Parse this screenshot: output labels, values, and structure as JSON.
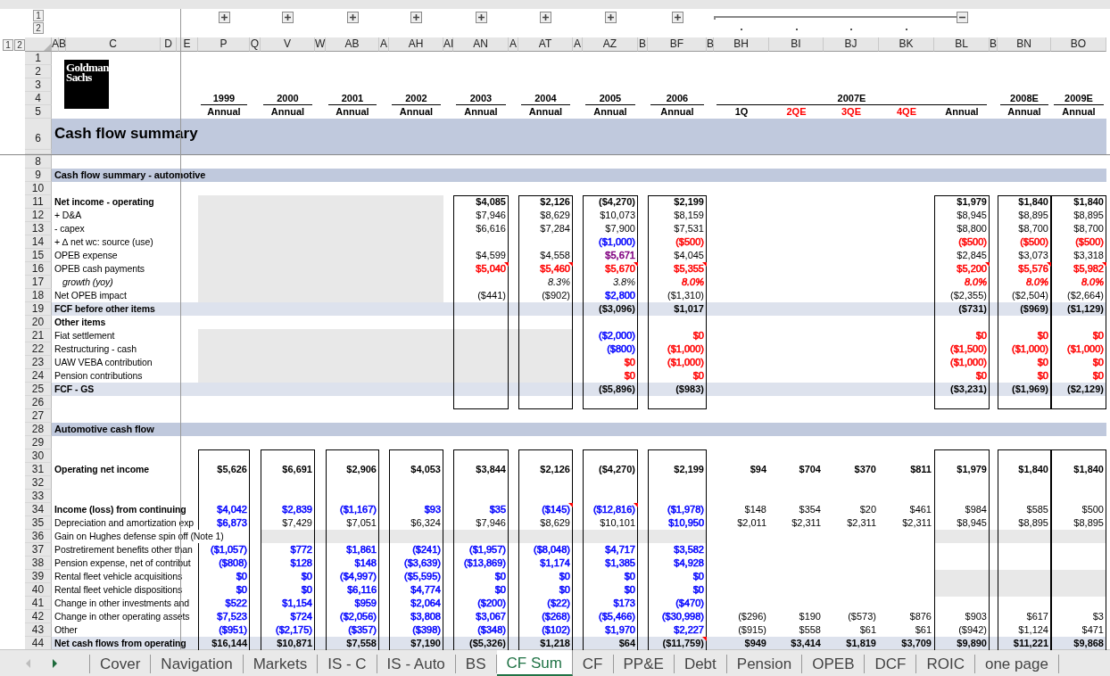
{
  "outline": {
    "levels": [
      "1",
      "2"
    ],
    "groups": [
      {
        "expanded": false
      },
      {
        "expanded": false
      },
      {
        "expanded": false
      },
      {
        "expanded": false
      },
      {
        "expanded": false
      },
      {
        "expanded": false
      },
      {
        "expanded": false
      },
      {
        "expanded": false
      },
      {
        "expanded": true
      }
    ]
  },
  "row_outline_levels": [
    "1",
    "2"
  ],
  "column_headers": [
    "A",
    "B",
    "C",
    "D",
    "E",
    "P",
    "Q",
    "V",
    "W",
    "AB",
    "A",
    "AH",
    "AI",
    "AN",
    "A",
    "AT",
    "A",
    "AZ",
    "B",
    "BF",
    "B",
    "BH",
    "BI",
    "BJ",
    "BK",
    "BL",
    "B",
    "BN",
    "BO"
  ],
  "header_row_numbers": [
    "1",
    "2",
    "3",
    "4",
    "5"
  ],
  "logo_lines": [
    "Goldman",
    "Sachs"
  ],
  "year_groups": [
    {
      "year": "1999",
      "periods": [
        {
          "label": "Annual"
        }
      ]
    },
    {
      "year": "2000",
      "periods": [
        {
          "label": "Annual"
        }
      ]
    },
    {
      "year": "2001",
      "periods": [
        {
          "label": "Annual"
        }
      ]
    },
    {
      "year": "2002",
      "periods": [
        {
          "label": "Annual"
        }
      ]
    },
    {
      "year": "2003",
      "periods": [
        {
          "label": "Annual"
        }
      ]
    },
    {
      "year": "2004",
      "periods": [
        {
          "label": "Annual"
        }
      ]
    },
    {
      "year": "2005",
      "periods": [
        {
          "label": "Annual"
        }
      ]
    },
    {
      "year": "2006",
      "periods": [
        {
          "label": "Annual"
        }
      ]
    },
    {
      "year": "2007E",
      "periods": [
        {
          "label": "1Q"
        },
        {
          "label": "2QE",
          "color": "#ff0000"
        },
        {
          "label": "3QE",
          "color": "#ff0000"
        },
        {
          "label": "4QE",
          "color": "#ff0000"
        },
        {
          "label": "Annual"
        }
      ]
    },
    {
      "year": "2008E",
      "periods": [
        {
          "label": "Annual"
        }
      ]
    },
    {
      "year": "2009E",
      "periods": [
        {
          "label": "Annual"
        }
      ]
    }
  ],
  "title": {
    "row": "6",
    "text": "Cash flow summary"
  },
  "rows": [
    {
      "num": "8",
      "kind": "blank"
    },
    {
      "num": "9",
      "kind": "section",
      "label": "Cash flow summary - automotive"
    },
    {
      "num": "10",
      "kind": "blank"
    },
    {
      "num": "11",
      "kind": "bold",
      "label": "Net income - operating",
      "values": {
        "AN": "$4,085",
        "AT": "$2,126",
        "AZ": "($4,270)",
        "BF": "$2,199",
        "BL": "$1,979",
        "BN": "$1,840",
        "BO": "$1,840"
      }
    },
    {
      "num": "12",
      "kind": "normal",
      "label": "+ D&A",
      "values": {
        "AN": "$7,946",
        "AT": "$8,629",
        "AZ": "$10,073",
        "BF": "$8,159",
        "BL": "$8,945",
        "BN": "$8,895",
        "BO": "$8,895"
      }
    },
    {
      "num": "13",
      "kind": "normal",
      "label": "- capex",
      "values": {
        "AN": "$6,616",
        "AT": "$7,284",
        "AZ": "$7,900",
        "BF": "$7,531",
        "BL": "$8,800",
        "BN": "$8,700",
        "BO": "$8,700"
      }
    },
    {
      "num": "14",
      "kind": "normal",
      "label": "+ ∆ net wc: source (use)",
      "values": {
        "AZ": {
          "text": "($1,000)",
          "color": "#0000ff"
        },
        "BF": {
          "text": "($500)",
          "color": "#ff0000"
        },
        "BL": {
          "text": "($500)",
          "color": "#ff0000"
        },
        "BN": {
          "text": "($500)",
          "color": "#ff0000"
        },
        "BO": {
          "text": "($500)",
          "color": "#ff0000"
        }
      }
    },
    {
      "num": "15",
      "kind": "normal",
      "label": "OPEB expense",
      "values": {
        "AN": "$4,599",
        "AT": "$4,558",
        "AZ": {
          "text": "$5,671",
          "color": "#800080"
        },
        "BF": "$4,045",
        "BL": "$2,845",
        "BN": "$3,073",
        "BO": "$3,318"
      }
    },
    {
      "num": "16",
      "kind": "normal",
      "label": "OPEB cash payments",
      "values": {
        "AN": {
          "text": "$5,040",
          "color": "#ff0000",
          "comment": true
        },
        "AT": {
          "text": "$5,460",
          "color": "#ff0000",
          "comment": true
        },
        "AZ": {
          "text": "$5,670",
          "color": "#ff0000",
          "comment": true
        },
        "BF": {
          "text": "$5,355",
          "color": "#ff0000",
          "comment": true
        },
        "BL": {
          "text": "$5,200",
          "color": "#ff0000",
          "comment": true
        },
        "BN": {
          "text": "$5,576",
          "color": "#ff0000",
          "comment": true
        },
        "BO": {
          "text": "$5,982",
          "color": "#ff0000",
          "comment": true
        }
      }
    },
    {
      "num": "17",
      "kind": "italic",
      "label": "growth (yoy)",
      "values": {
        "AT": "8.3%",
        "AZ": "3.8%",
        "BF": {
          "text": "8.0%",
          "color": "#ff0000"
        },
        "BL": {
          "text": "8.0%",
          "color": "#ff0000"
        },
        "BN": {
          "text": "8.0%",
          "color": "#ff0000"
        },
        "BO": {
          "text": "8.0%",
          "color": "#ff0000"
        }
      }
    },
    {
      "num": "18",
      "kind": "normal",
      "label": "Net OPEB impact",
      "values": {
        "AN": "($441)",
        "AT": "($902)",
        "AZ": {
          "text": "$2,800",
          "color": "#0000ff"
        },
        "BF": "($1,310)",
        "BL": "($2,355)",
        "BN": "($2,504)",
        "BO": "($2,664)"
      }
    },
    {
      "num": "19",
      "kind": "total",
      "label": "FCF before other items",
      "values": {
        "AZ": "($3,096)",
        "BF": "$1,017",
        "BL": "($731)",
        "BN": "($969)",
        "BO": "($1,129)"
      }
    },
    {
      "num": "20",
      "kind": "heading",
      "label": "Other items"
    },
    {
      "num": "21",
      "kind": "normal",
      "label": "Fiat settlement",
      "values": {
        "AZ": {
          "text": "($2,000)",
          "color": "#0000ff"
        },
        "BF": {
          "text": "$0",
          "color": "#ff0000"
        },
        "BL": {
          "text": "$0",
          "color": "#ff0000"
        },
        "BN": {
          "text": "$0",
          "color": "#ff0000"
        },
        "BO": {
          "text": "$0",
          "color": "#ff0000"
        }
      }
    },
    {
      "num": "22",
      "kind": "normal",
      "label": "Restructuring - cash",
      "values": {
        "AZ": {
          "text": "($800)",
          "color": "#0000ff"
        },
        "BF": {
          "text": "($1,000)",
          "color": "#ff0000"
        },
        "BL": {
          "text": "($1,500)",
          "color": "#ff0000"
        },
        "BN": {
          "text": "($1,000)",
          "color": "#ff0000"
        },
        "BO": {
          "text": "($1,000)",
          "color": "#ff0000"
        }
      }
    },
    {
      "num": "23",
      "kind": "normal",
      "label": "UAW VEBA contribution",
      "values": {
        "AZ": {
          "text": "$0",
          "color": "#ff0000"
        },
        "BF": {
          "text": "($1,000)",
          "color": "#ff0000"
        },
        "BL": {
          "text": "($1,000)",
          "color": "#ff0000"
        },
        "BN": {
          "text": "$0",
          "color": "#ff0000"
        },
        "BO": {
          "text": "$0",
          "color": "#ff0000"
        }
      }
    },
    {
      "num": "24",
      "kind": "normal",
      "label": "Pension contributions",
      "values": {
        "AZ": {
          "text": "$0",
          "color": "#ff0000"
        },
        "BF": {
          "text": "$0",
          "color": "#ff0000"
        },
        "BL": {
          "text": "$0",
          "color": "#ff0000"
        },
        "BN": {
          "text": "$0",
          "color": "#ff0000"
        },
        "BO": {
          "text": "$0",
          "color": "#ff0000"
        }
      }
    },
    {
      "num": "25",
      "kind": "total",
      "label": "FCF - GS",
      "values": {
        "AZ": "($5,896)",
        "BF": "($983)",
        "BL": "($3,231)",
        "BN": "($1,969)",
        "BO": "($2,129)"
      }
    },
    {
      "num": "26",
      "kind": "blank"
    },
    {
      "num": "27",
      "kind": "blank"
    },
    {
      "num": "28",
      "kind": "section",
      "label": "Automotive cash flow"
    },
    {
      "num": "29",
      "kind": "blank"
    },
    {
      "num": "30",
      "kind": "blank"
    },
    {
      "num": "31",
      "kind": "bold",
      "label": "Operating net income",
      "values": {
        "P": "$5,626",
        "V": "$6,691",
        "AB": "$2,906",
        "AH": "$4,053",
        "AN": "$3,844",
        "AT": "$2,126",
        "AZ": "($4,270)",
        "BF": "$2,199",
        "BH": "$94",
        "BI": "$704",
        "BJ": "$370",
        "BK": "$811",
        "BL": "$1,979",
        "BN": "$1,840",
        "BO": "$1,840"
      }
    },
    {
      "num": "32",
      "kind": "blank"
    },
    {
      "num": "33",
      "kind": "blank"
    },
    {
      "num": "34",
      "kind": "heading",
      "label": "Income (loss) from continuing",
      "values": {
        "P": {
          "text": "$4,042",
          "color": "#0000ff"
        },
        "V": {
          "text": "$2,839",
          "color": "#0000ff"
        },
        "AB": {
          "text": "($1,167)",
          "color": "#0000ff"
        },
        "AH": {
          "text": "$93",
          "color": "#0000ff"
        },
        "AN": {
          "text": "$35",
          "color": "#0000ff"
        },
        "AT": {
          "text": "($145)",
          "color": "#0000ff",
          "comment": true
        },
        "AZ": {
          "text": "($12,816)",
          "color": "#0000ff",
          "comment": true
        },
        "BF": {
          "text": "($1,978)",
          "color": "#0000ff"
        },
        "BH": "$148",
        "BI": "$354",
        "BJ": "$20",
        "BK": "$461",
        "BL": "$984",
        "BN": "$585",
        "BO": "$500"
      }
    },
    {
      "num": "35",
      "kind": "normal",
      "label": "Depreciation and amortization exp",
      "values": {
        "P": {
          "text": "$6,873",
          "color": "#0000ff"
        },
        "V": "$7,429",
        "AB": "$7,051",
        "AH": "$6,324",
        "AN": "$7,946",
        "AT": "$8,629",
        "AZ": "$10,101",
        "BF": {
          "text": "$10,950",
          "color": "#0000ff"
        },
        "BH": "$2,011",
        "BI": "$2,311",
        "BJ": "$2,311",
        "BK": "$2,311",
        "BL": "$8,945",
        "BN": "$8,895",
        "BO": "$8,895"
      }
    },
    {
      "num": "36",
      "kind": "note",
      "label": "Gain on Hughes defense spin off (Note 1)"
    },
    {
      "num": "37",
      "kind": "normal",
      "label": "Postretirement benefits other than",
      "values": {
        "P": {
          "text": "($1,057)",
          "color": "#0000ff"
        },
        "V": {
          "text": "$772",
          "color": "#0000ff"
        },
        "AB": {
          "text": "$1,861",
          "color": "#0000ff"
        },
        "AH": {
          "text": "($241)",
          "color": "#0000ff"
        },
        "AN": {
          "text": "($1,957)",
          "color": "#0000ff"
        },
        "AT": {
          "text": "($8,048)",
          "color": "#0000ff"
        },
        "AZ": {
          "text": "$4,717",
          "color": "#0000ff"
        },
        "BF": {
          "text": "$3,582",
          "color": "#0000ff"
        }
      }
    },
    {
      "num": "38",
      "kind": "normal",
      "label": "Pension expense, net of contribut",
      "values": {
        "P": {
          "text": "($808)",
          "color": "#0000ff"
        },
        "V": {
          "text": "$128",
          "color": "#0000ff"
        },
        "AB": {
          "text": "$148",
          "color": "#0000ff"
        },
        "AH": {
          "text": "($3,639)",
          "color": "#0000ff"
        },
        "AN": {
          "text": "($13,869)",
          "color": "#0000ff"
        },
        "AT": {
          "text": "$1,174",
          "color": "#0000ff"
        },
        "AZ": {
          "text": "$1,385",
          "color": "#0000ff"
        },
        "BF": {
          "text": "$4,928",
          "color": "#0000ff"
        }
      }
    },
    {
      "num": "39",
      "kind": "normal",
      "label": "Rental fleet vehicle acquisitions",
      "values": {
        "P": {
          "text": "$0",
          "color": "#0000ff"
        },
        "V": {
          "text": "$0",
          "color": "#0000ff"
        },
        "AB": {
          "text": "($4,997)",
          "color": "#0000ff"
        },
        "AH": {
          "text": "($5,595)",
          "color": "#0000ff"
        },
        "AN": {
          "text": "$0",
          "color": "#0000ff"
        },
        "AT": {
          "text": "$0",
          "color": "#0000ff"
        },
        "AZ": {
          "text": "$0",
          "color": "#0000ff"
        },
        "BF": {
          "text": "$0",
          "color": "#0000ff"
        }
      }
    },
    {
      "num": "40",
      "kind": "normal",
      "label": "Rental fleet vehicle dispositions",
      "values": {
        "P": {
          "text": "$0",
          "color": "#0000ff"
        },
        "V": {
          "text": "$0",
          "color": "#0000ff"
        },
        "AB": {
          "text": "$6,116",
          "color": "#0000ff"
        },
        "AH": {
          "text": "$4,774",
          "color": "#0000ff"
        },
        "AN": {
          "text": "$0",
          "color": "#0000ff"
        },
        "AT": {
          "text": "$0",
          "color": "#0000ff"
        },
        "AZ": {
          "text": "$0",
          "color": "#0000ff"
        },
        "BF": {
          "text": "$0",
          "color": "#0000ff"
        }
      }
    },
    {
      "num": "41",
      "kind": "normal",
      "label": "Change in other investments and",
      "values": {
        "P": {
          "text": "$522",
          "color": "#0000ff"
        },
        "V": {
          "text": "$1,154",
          "color": "#0000ff"
        },
        "AB": {
          "text": "$959",
          "color": "#0000ff"
        },
        "AH": {
          "text": "$2,064",
          "color": "#0000ff"
        },
        "AN": {
          "text": "($200)",
          "color": "#0000ff"
        },
        "AT": {
          "text": "($22)",
          "color": "#0000ff"
        },
        "AZ": {
          "text": "$173",
          "color": "#0000ff"
        },
        "BF": {
          "text": "($470)",
          "color": "#0000ff"
        }
      }
    },
    {
      "num": "42",
      "kind": "normal",
      "label": "Change in other operating assets",
      "values": {
        "P": {
          "text": "$7,523",
          "color": "#0000ff"
        },
        "V": {
          "text": "$724",
          "color": "#0000ff"
        },
        "AB": {
          "text": "($2,056)",
          "color": "#0000ff"
        },
        "AH": {
          "text": "$3,808",
          "color": "#0000ff"
        },
        "AN": {
          "text": "$3,067",
          "color": "#0000ff"
        },
        "AT": {
          "text": "($268)",
          "color": "#0000ff"
        },
        "AZ": {
          "text": "($5,466)",
          "color": "#0000ff"
        },
        "BF": {
          "text": "($30,998)",
          "color": "#0000ff"
        },
        "BH": "($296)",
        "BI": "$190",
        "BJ": "($573)",
        "BK": "$876",
        "BL": "$903",
        "BN": "$617",
        "BO": "$3"
      }
    },
    {
      "num": "43",
      "kind": "normal",
      "label": "Other",
      "values": {
        "P": {
          "text": "($951)",
          "color": "#0000ff"
        },
        "V": {
          "text": "($2,175)",
          "color": "#0000ff"
        },
        "AB": {
          "text": "($357)",
          "color": "#0000ff"
        },
        "AH": {
          "text": "($398)",
          "color": "#0000ff"
        },
        "AN": {
          "text": "($348)",
          "color": "#0000ff"
        },
        "AT": {
          "text": "($102)",
          "color": "#0000ff"
        },
        "AZ": {
          "text": "$1,970",
          "color": "#0000ff"
        },
        "BF": {
          "text": "$2,227",
          "color": "#0000ff"
        },
        "BH": "($915)",
        "BI": "$558",
        "BJ": "$61",
        "BK": "$61",
        "BL": "($942)",
        "BN": "$1,124",
        "BO": "$471"
      }
    },
    {
      "num": "44",
      "kind": "total",
      "label": "Net cash flows from operating",
      "values": {
        "P": "$16,144",
        "V": "$10,871",
        "AB": "$7,558",
        "AH": "$7,190",
        "AN": "($5,326)",
        "AT": "$1,218",
        "AZ": "$64",
        "BF": {
          "text": "($11,759)",
          "comment": true
        },
        "BH": "$949",
        "BI": "$3,414",
        "BJ": "$1,819",
        "BK": "$3,709",
        "BL": "$9,890",
        "BN": "$11,221",
        "BO": "$9,868"
      }
    }
  ],
  "sheet_nav": [
    {
      "kind": "previous",
      "disabled": true
    },
    {
      "kind": "next",
      "disabled": false
    }
  ],
  "sheet_tabs": [
    {
      "label": "Cover",
      "selected": false
    },
    {
      "label": "Navigation",
      "selected": false
    },
    {
      "label": "Markets",
      "selected": false
    },
    {
      "label": "IS - C",
      "selected": false
    },
    {
      "label": "IS - Auto",
      "selected": false
    },
    {
      "label": "BS",
      "selected": false
    },
    {
      "label": "CF Sum",
      "selected": true
    },
    {
      "label": "CF",
      "selected": false
    },
    {
      "label": "PP&E",
      "selected": false
    },
    {
      "label": "Debt",
      "selected": false
    },
    {
      "label": "Pension",
      "selected": false
    },
    {
      "label": "OPEB",
      "selected": false
    },
    {
      "label": "DCF",
      "selected": false
    },
    {
      "label": "ROIC",
      "selected": false
    },
    {
      "label": "one page",
      "selected": false
    }
  ]
}
